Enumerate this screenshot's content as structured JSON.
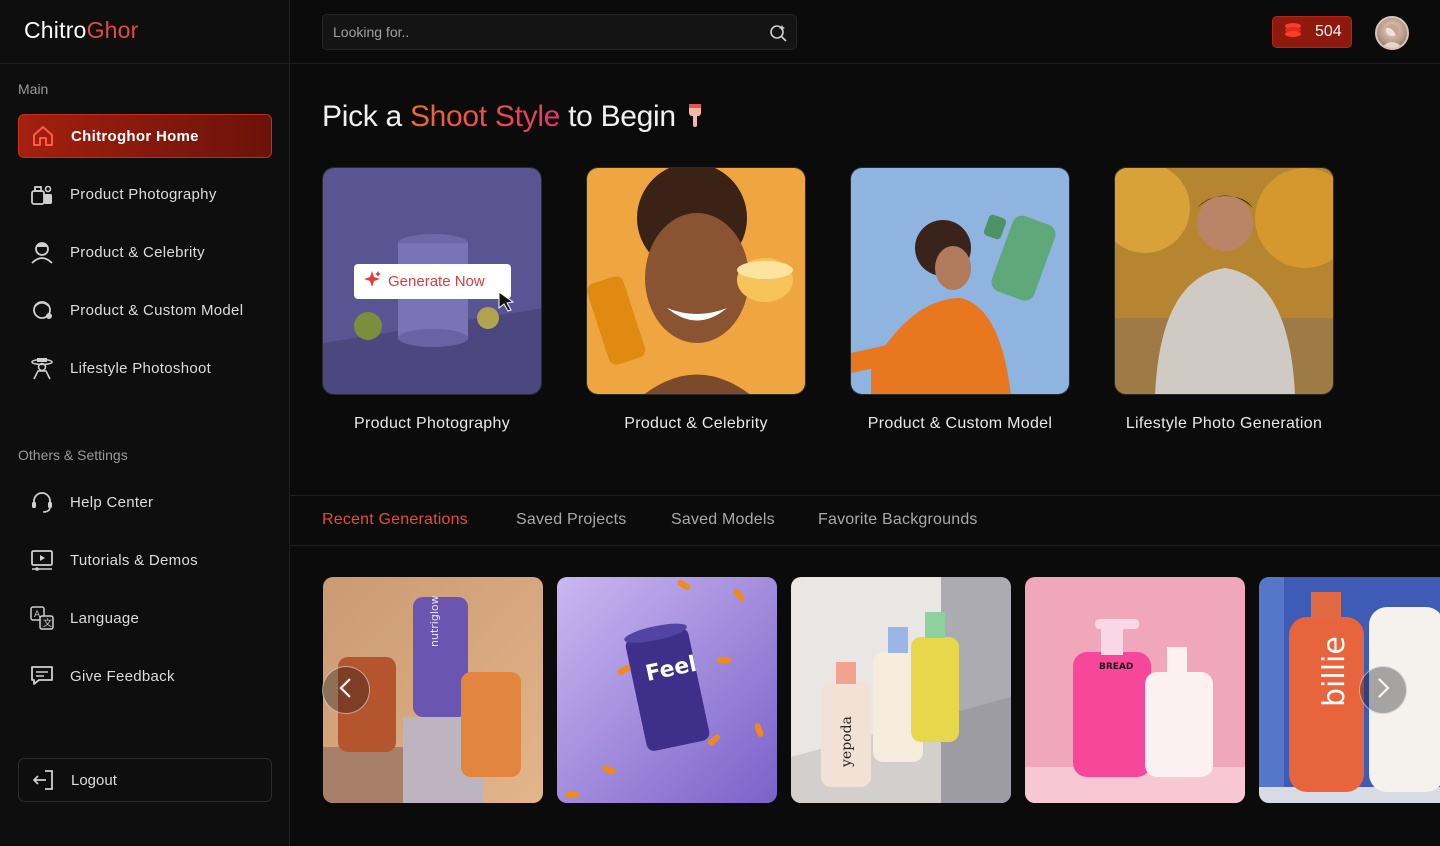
{
  "brand": {
    "part1": "Chitro",
    "part2": "Ghor"
  },
  "sidebar": {
    "main_label": "Main",
    "main_items": [
      {
        "label": "Chitroghor Home",
        "icon": "home-icon",
        "active": true
      },
      {
        "label": "Product Photography",
        "icon": "product-camera-icon"
      },
      {
        "label": "Product & Celebrity",
        "icon": "celebrity-icon"
      },
      {
        "label": "Product & Custom Model",
        "icon": "custom-model-icon"
      },
      {
        "label": "Lifestyle Photoshoot",
        "icon": "lifestyle-icon"
      }
    ],
    "settings_label": "Others & Settings",
    "settings_items": [
      {
        "label": "Help Center",
        "icon": "headset-icon"
      },
      {
        "label": "Tutorials & Demos",
        "icon": "video-player-icon"
      },
      {
        "label": "Language",
        "icon": "translate-icon"
      },
      {
        "label": "Give Feedback",
        "icon": "chat-icon"
      }
    ],
    "logout_label": "Logout"
  },
  "topbar": {
    "search_placeholder": "Looking for..",
    "credits": "504"
  },
  "main": {
    "heading_pre": "Pick a ",
    "heading_accent": "Shoot Style",
    "heading_post": " to Begin",
    "heading_emoji": "👇",
    "generate_label": "Generate Now",
    "styles": [
      {
        "label": "Product Photography"
      },
      {
        "label": "Product & Celebrity"
      },
      {
        "label": "Product & Custom Model"
      },
      {
        "label": "Lifestyle Photo Generation"
      }
    ],
    "tabs": [
      {
        "label": "Recent Generations",
        "active": true
      },
      {
        "label": "Saved Projects"
      },
      {
        "label": "Saved Models"
      },
      {
        "label": "Favorite Backgrounds"
      }
    ],
    "generations": [
      {
        "brand_text": "nutriglow"
      },
      {
        "brand_text": "Feel"
      },
      {
        "brand_text": "yepoda"
      },
      {
        "brand_text": "BREAD"
      },
      {
        "brand_text": "billie"
      }
    ]
  },
  "colors": {
    "accent": "#e64a3b",
    "active_nav": "#a3200f",
    "background": "#0b0b0b"
  }
}
